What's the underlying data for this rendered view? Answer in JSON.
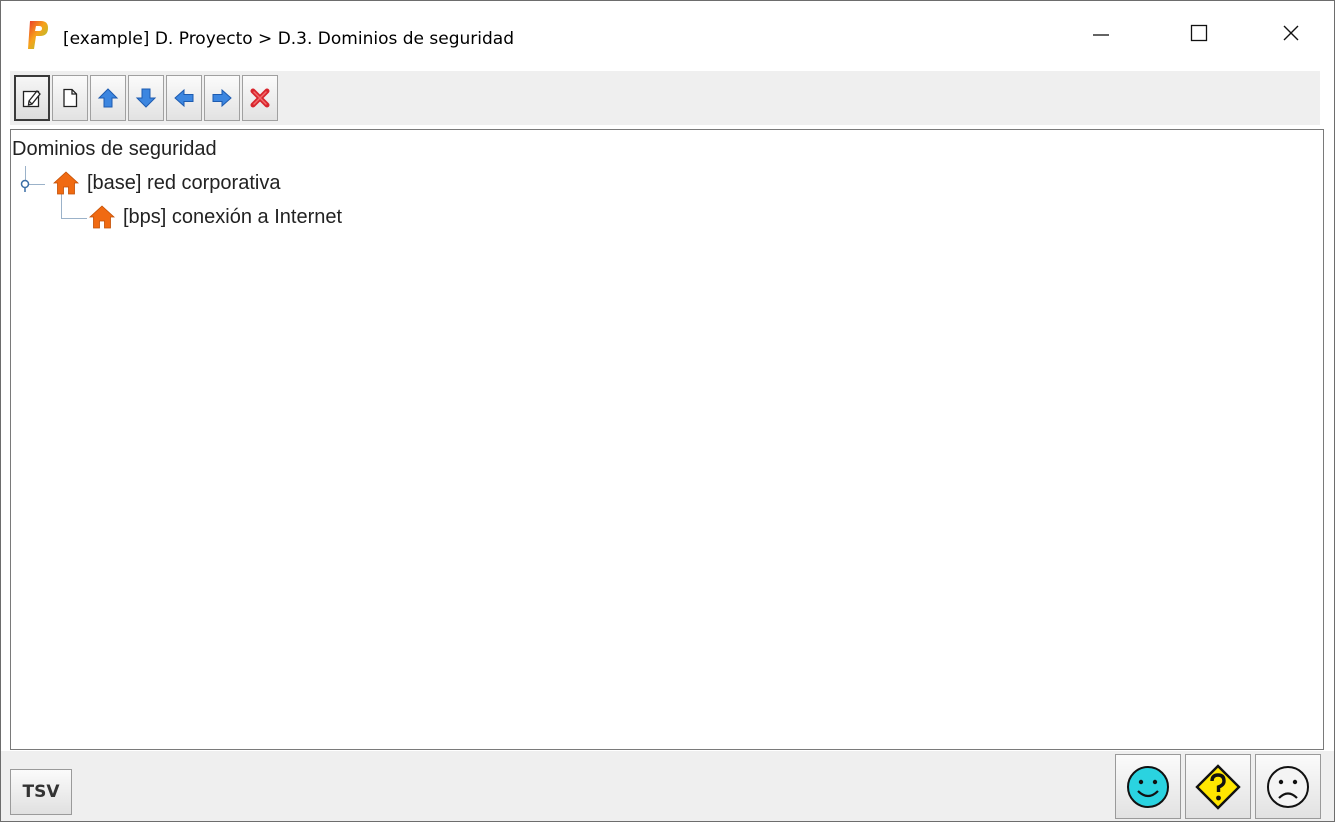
{
  "window": {
    "title": "[example] D. Proyecto > D.3. Dominios de seguridad",
    "app_icon": "p-logo-icon",
    "controls": [
      "minimize-icon",
      "maximize-icon",
      "close-icon"
    ]
  },
  "toolbar": {
    "buttons": [
      {
        "icon": "edit-icon",
        "active": true
      },
      {
        "icon": "new-document-icon"
      },
      {
        "icon": "arrow-up-icon"
      },
      {
        "icon": "arrow-down-icon"
      },
      {
        "icon": "arrow-left-icon"
      },
      {
        "icon": "arrow-right-icon"
      },
      {
        "icon": "delete-icon"
      }
    ],
    "arrow_color": "#3c86e0",
    "delete_color": "#d8262e"
  },
  "tree": {
    "root_label": "Dominios de seguridad",
    "nodes": [
      {
        "label": "[base] red corporativa",
        "icon": "house-icon",
        "level": 0
      },
      {
        "label": "[bps] conexión a Internet",
        "icon": "house-icon",
        "level": 1
      }
    ],
    "house_color": "#f06a12"
  },
  "bottom": {
    "tsv_label": "TSV",
    "status_buttons": [
      {
        "icon": "happy-face-icon",
        "color": "#2ad3e0"
      },
      {
        "icon": "question-sign-icon",
        "color": "#ffe600"
      },
      {
        "icon": "sad-face-icon",
        "color": "#f4f4f4"
      }
    ]
  }
}
